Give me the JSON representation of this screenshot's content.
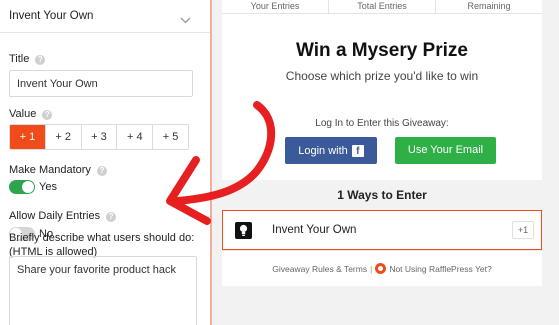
{
  "left": {
    "header_title": "Invent Your Own",
    "title_label": "Title",
    "title_value": "Invent Your Own",
    "value_label": "Value",
    "value_options": [
      "+ 1",
      "+ 2",
      "+ 3",
      "+ 4",
      "+ 5"
    ],
    "value_selected": "+ 1",
    "mandatory_label": "Make Mandatory",
    "mandatory_state": "Yes",
    "daily_label": "Allow Daily Entries",
    "daily_state": "No",
    "describe_label": "Briefly describe what users should do: (HTML is allowed)",
    "describe_value": "Share your favorite product hack",
    "help_glyph": "?"
  },
  "preview": {
    "stats": [
      "Your Entries",
      "Total Entries",
      "Remaining"
    ],
    "title": "Win a Mysery Prize",
    "subtitle": "Choose which prize you'd like to win",
    "login_prompt": "Log In to Enter this Giveaway:",
    "login_button": "Login with",
    "email_button": "Use Your Email",
    "ways_heading": "1 Ways to Enter",
    "entry_name": "Invent Your Own",
    "entry_points": "+1",
    "footer_rules": "Giveaway Rules & Terms",
    "footer_sep": "|",
    "footer_notusing": "Not Using RafflePress Yet?"
  },
  "colors": {
    "accent": "#ef4b1b",
    "toggle_on": "#2ea44f",
    "facebook": "#3b5a9a",
    "email": "#2eb046",
    "arrow": "#e62020"
  },
  "icons": [
    "chevron-down-icon",
    "help-icon",
    "facebook-icon",
    "lightbulb-icon",
    "rafflepress-icon"
  ]
}
